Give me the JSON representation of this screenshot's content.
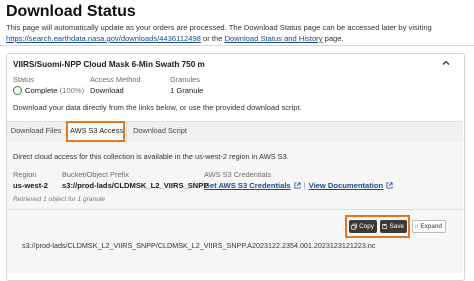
{
  "page": {
    "title": "Download Status",
    "intro_text": "This page will automatically update as your orders are processed. The Download Status page can be accessed later by visiting",
    "intro_link_url": "https://search.earthdata.nasa.gov/downloads/4436112498",
    "intro_or": " or the ",
    "intro_link_history": "Download Status and History",
    "intro_end": " page."
  },
  "collection": {
    "title": "VIIRS/Suomi-NPP Cloud Mask 6-Min Swath 750 m",
    "status_label": "Status",
    "status_value": "Complete",
    "status_pct": "(100%)",
    "access_label": "Access Method",
    "access_value": "Download",
    "granules_label": "Granules",
    "granules_value": "1 Granule",
    "message": "Download your data directly from the links below, or use the provided download script."
  },
  "tabs": {
    "files": "Download Files",
    "s3": "AWS S3 Access",
    "script": "Download Script"
  },
  "s3": {
    "description": "Direct cloud access for this collection is available in the us-west-2 region in AWS S3.",
    "region_label": "Region",
    "region_value": "us-west-2",
    "bucket_label": "Bucket/Object Prefix",
    "bucket_value": "s3://prod-lads/CLDMSK_L2_VIIRS_SNPP",
    "creds_label": "AWS S3 Credentials",
    "creds_link": "Get AWS S3 Credentials",
    "docs_link": "View Documentation",
    "retrieved": "Retrieved 1 object for 1 granule",
    "copy": "Copy",
    "save": "Save",
    "expand": "Expand",
    "object_path": "s3://prod-lads/CLDMSK_L2_VIIRS_SNPP/CLDMSK_L2_VIIRS_SNPP.A2023122.2354.001.2023123121223.nc"
  },
  "colors": {
    "accent_orange": "#e8761f",
    "link_blue": "#1a4b8c",
    "status_green": "#2e8540"
  },
  "icons": {
    "chevron": "chevron-up-icon",
    "status": "check-circle-icon",
    "external": "external-link-icon",
    "copy": "copy-icon",
    "save": "save-icon",
    "expand": "expand-icon"
  }
}
